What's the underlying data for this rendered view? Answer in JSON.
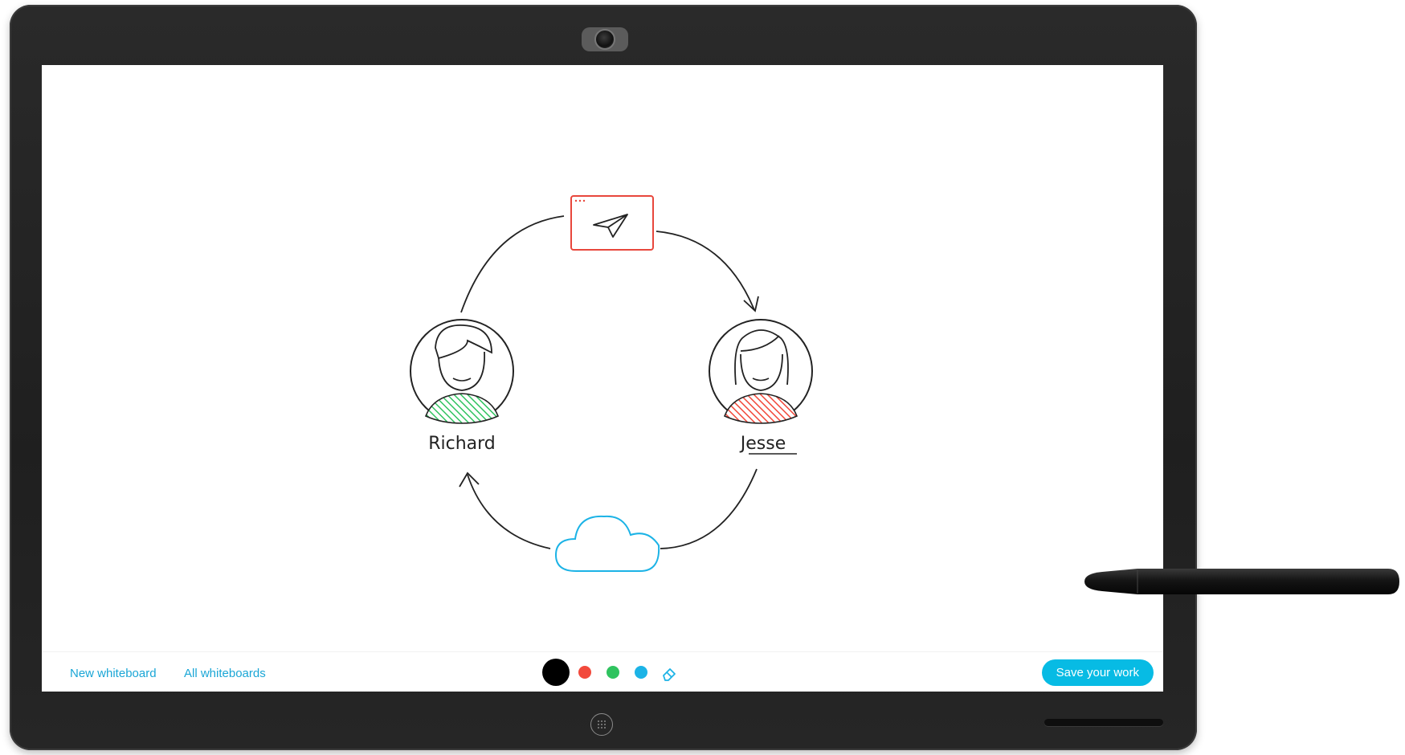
{
  "toolbar": {
    "new_whiteboard": "New whiteboard",
    "all_whiteboards": "All whiteboards",
    "save_label": "Save your work",
    "colors": [
      {
        "name": "black",
        "hex": "#000000",
        "selected": true
      },
      {
        "name": "red",
        "hex": "#f24a3c",
        "selected": false
      },
      {
        "name": "green",
        "hex": "#2fc35f",
        "selected": false
      },
      {
        "name": "blue",
        "hex": "#1cb3e6",
        "selected": false
      }
    ],
    "eraser_icon": "eraser-icon",
    "accent": "#07bbe4"
  },
  "whiteboard": {
    "person_left": "Richard",
    "person_right": "Jesse",
    "icons": [
      "paper-plane-icon",
      "cloud-icon"
    ]
  }
}
